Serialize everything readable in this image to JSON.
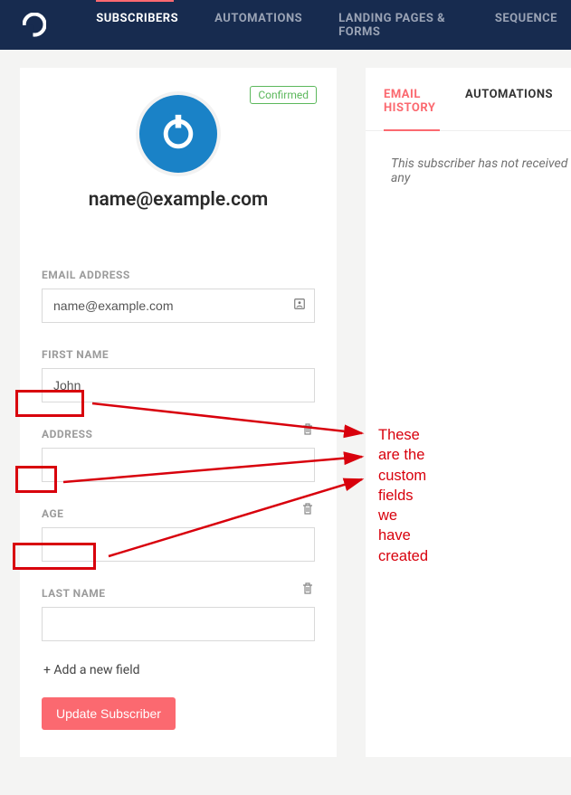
{
  "nav": {
    "items": [
      {
        "label": "SUBSCRIBERS",
        "active": true
      },
      {
        "label": "AUTOMATIONS"
      },
      {
        "label": "LANDING PAGES & FORMS"
      },
      {
        "label": "SEQUENCE"
      }
    ]
  },
  "subscriber": {
    "status_badge": "Confirmed",
    "email_display": "name@example.com"
  },
  "form": {
    "email": {
      "label": "EMAIL ADDRESS",
      "value": "name@example.com"
    },
    "first_name": {
      "label": "FIRST NAME",
      "value": "John"
    },
    "custom": [
      {
        "label": "ADDRESS",
        "value": ""
      },
      {
        "label": "AGE",
        "value": ""
      },
      {
        "label": "LAST NAME",
        "value": ""
      }
    ],
    "add_field": "+ Add a new field",
    "submit": "Update Subscriber"
  },
  "right": {
    "tabs": [
      {
        "label": "EMAIL HISTORY",
        "active": true
      },
      {
        "label": "AUTOMATIONS"
      }
    ],
    "empty_message": "This subscriber has not received any"
  },
  "annotation": {
    "text": "These are the custom\nfields we have created"
  }
}
